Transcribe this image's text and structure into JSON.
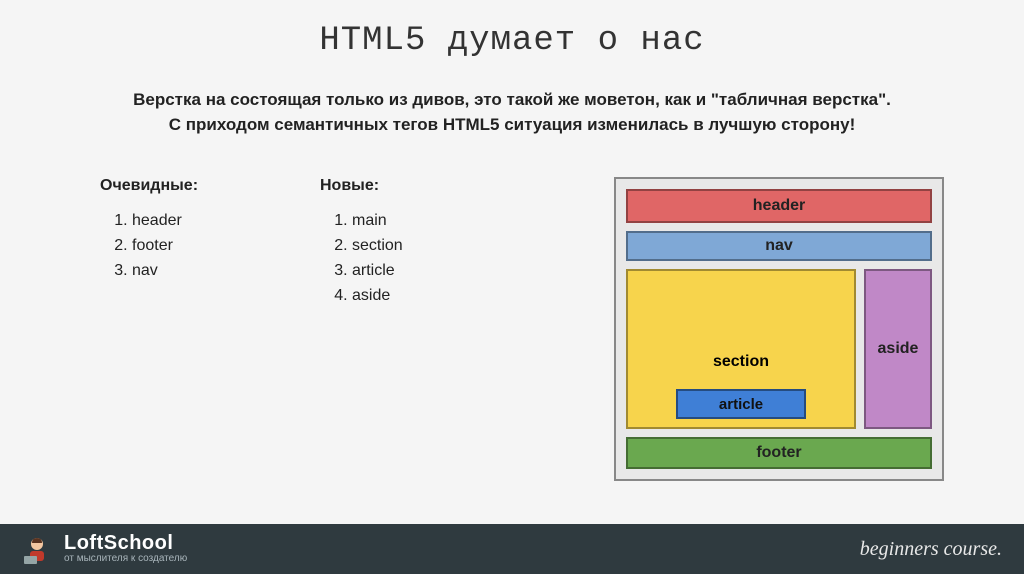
{
  "title": "HTML5 думает о нас",
  "subtitle_line1": "Верстка на состоящая только из дивов, это такой же моветон, как и \"табличная верстка\".",
  "subtitle_line2": "С приходом семантичных тегов HTML5 ситуация изменилась в лучшую сторону!",
  "obvious": {
    "heading": "Очевидные:",
    "items": [
      "header",
      "footer",
      "nav"
    ]
  },
  "new": {
    "heading": "Новые:",
    "items": [
      "main",
      "section",
      "article",
      "aside"
    ]
  },
  "diagram": {
    "header": "header",
    "nav": "nav",
    "section": "section",
    "article": "article",
    "aside": "aside",
    "footer": "footer"
  },
  "footer": {
    "brand": "LoftSchool",
    "tagline": "от мыслителя к создателю",
    "course": "beginners course."
  }
}
